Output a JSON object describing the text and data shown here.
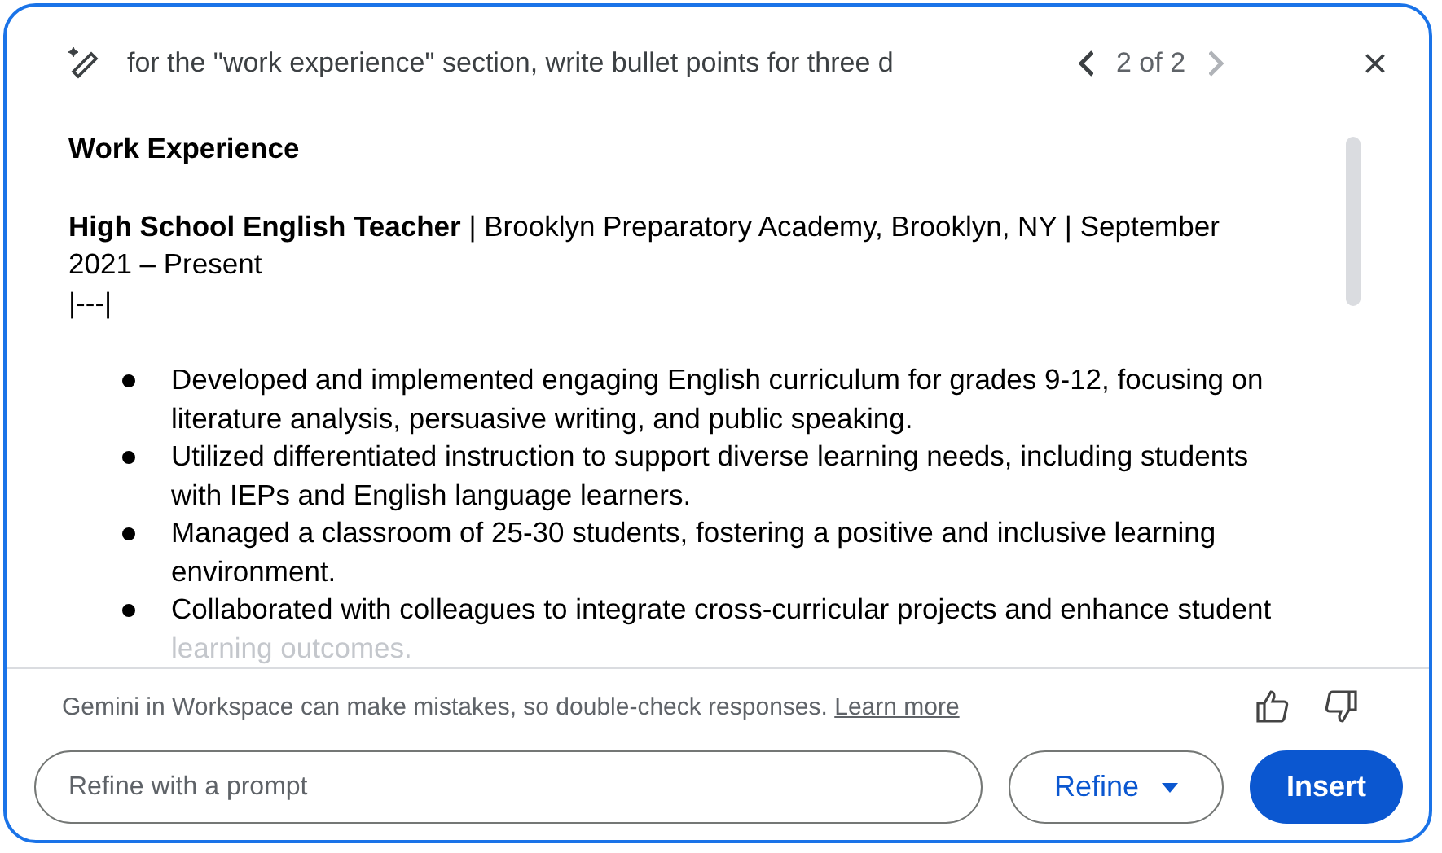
{
  "header": {
    "prompt": "for the \"work experience\" section, write bullet points for three d",
    "pager": "2 of 2",
    "prev_disabled": false,
    "next_disabled": true
  },
  "response": {
    "heading": "Work Experience",
    "job_line": "**High School English Teacher** | Brooklyn Preparatory Academy, Brooklyn, NY | September 2021 – Present",
    "separator": "|---|",
    "bullets": [
      {
        "text": "Developed and implemented engaging English curriculum for grades 9-12, focusing on literature analysis, persuasive writing, and public speaking."
      },
      {
        "text": "Utilized differentiated instruction to support diverse learning needs, including students with IEPs and English language learners."
      },
      {
        "text": "Managed a classroom of 25-30 students, fostering a positive and inclusive learning environment."
      },
      {
        "text": "Collaborated with colleagues to integrate cross-curricular projects and enhance student",
        "faded_tail": "learning outcomes."
      }
    ]
  },
  "footer": {
    "disclaimer": "Gemini in Workspace can make mistakes, so double-check responses.",
    "link": "Learn more"
  },
  "refine_field": {
    "placeholder": "Refine with a prompt"
  },
  "buttons": {
    "refine": "Refine",
    "insert": "Insert"
  }
}
